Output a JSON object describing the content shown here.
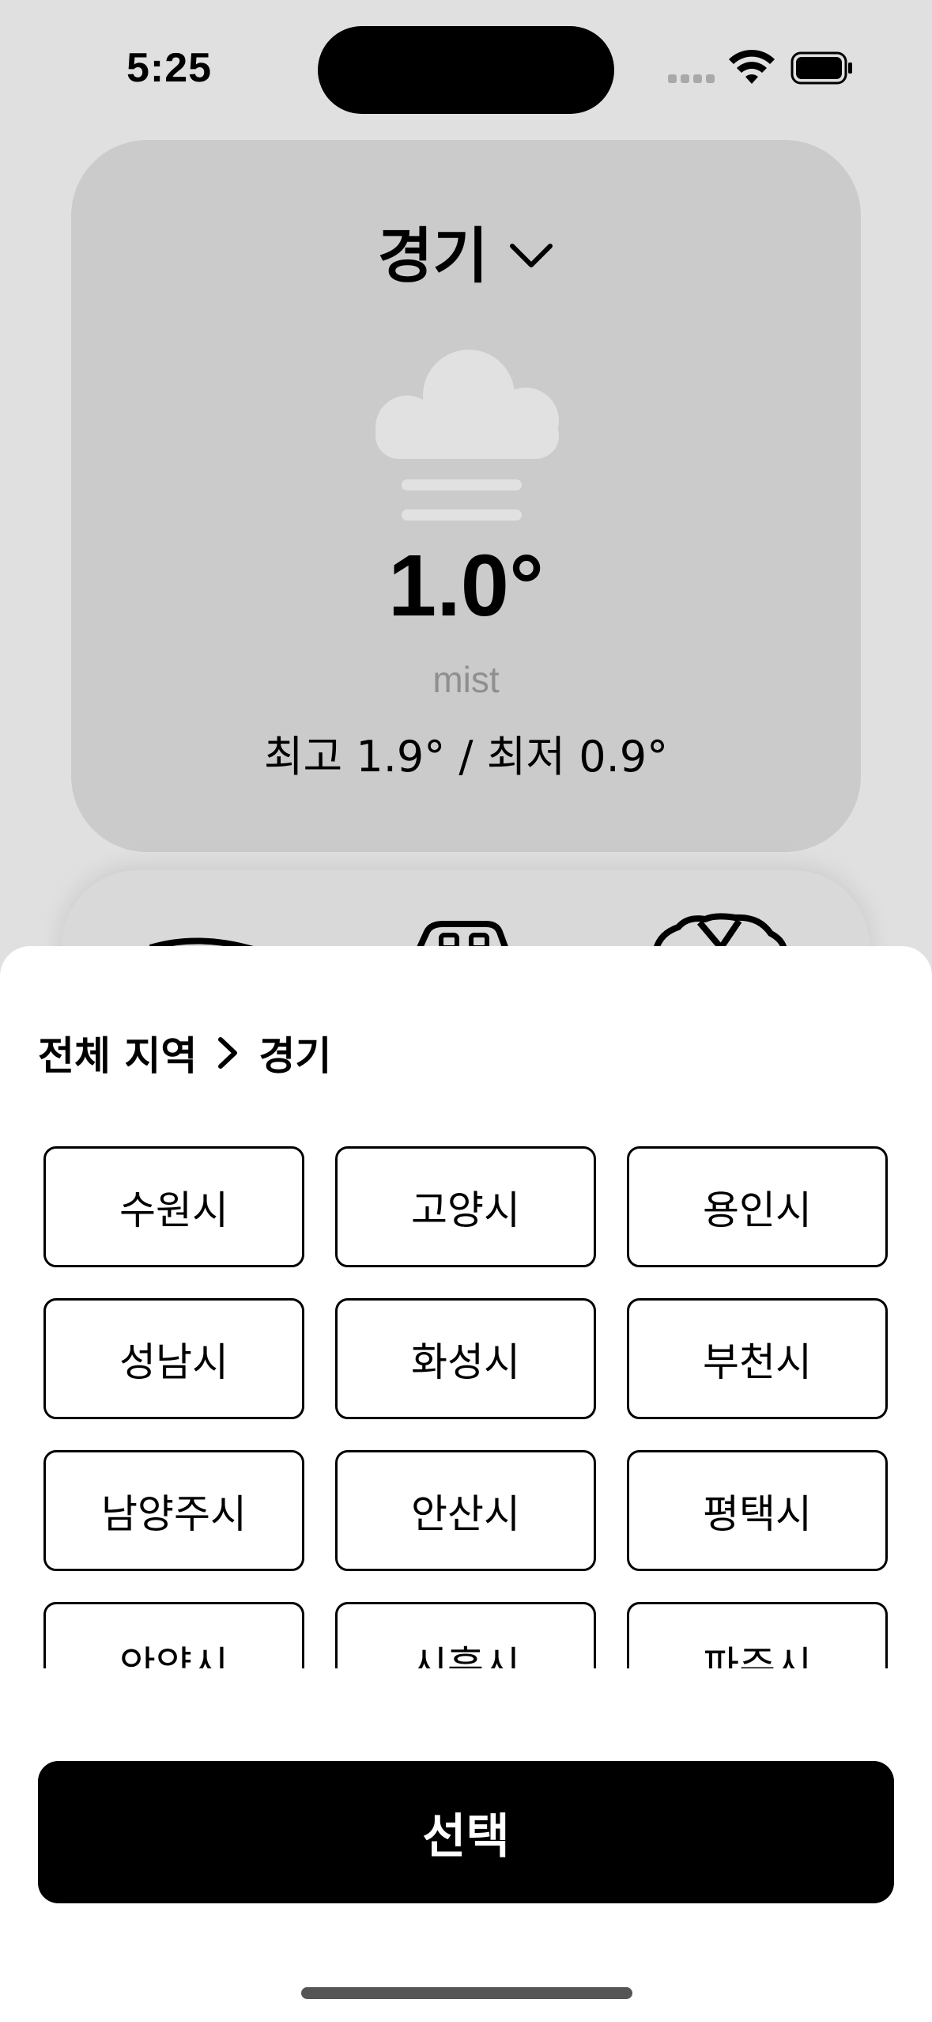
{
  "status_bar": {
    "time": "5:25",
    "icons": [
      "cellular-signal-icon",
      "wifi-icon",
      "battery-icon"
    ]
  },
  "weather_card": {
    "region": "경기",
    "icon": "mist-cloud-icon",
    "temperature": "1.0°",
    "condition": "mist",
    "min_max": "최고 1.9° / 최저 0.9°"
  },
  "region_sheet": {
    "breadcrumb": {
      "root": "전체 지역",
      "current": "경기"
    },
    "cities": [
      {
        "label": "수원시"
      },
      {
        "label": "고양시"
      },
      {
        "label": "용인시"
      },
      {
        "label": "성남시"
      },
      {
        "label": "화성시"
      },
      {
        "label": "부천시"
      },
      {
        "label": "남양주시"
      },
      {
        "label": "안산시"
      },
      {
        "label": "평택시"
      },
      {
        "label": "안양시"
      },
      {
        "label": "시흥시"
      },
      {
        "label": "파주시"
      }
    ],
    "select_label": "선택"
  },
  "colors": {
    "background": "#e0e0e0",
    "card": "#cbcbcb",
    "sheet": "#ffffff",
    "primary_button": "#000000"
  }
}
